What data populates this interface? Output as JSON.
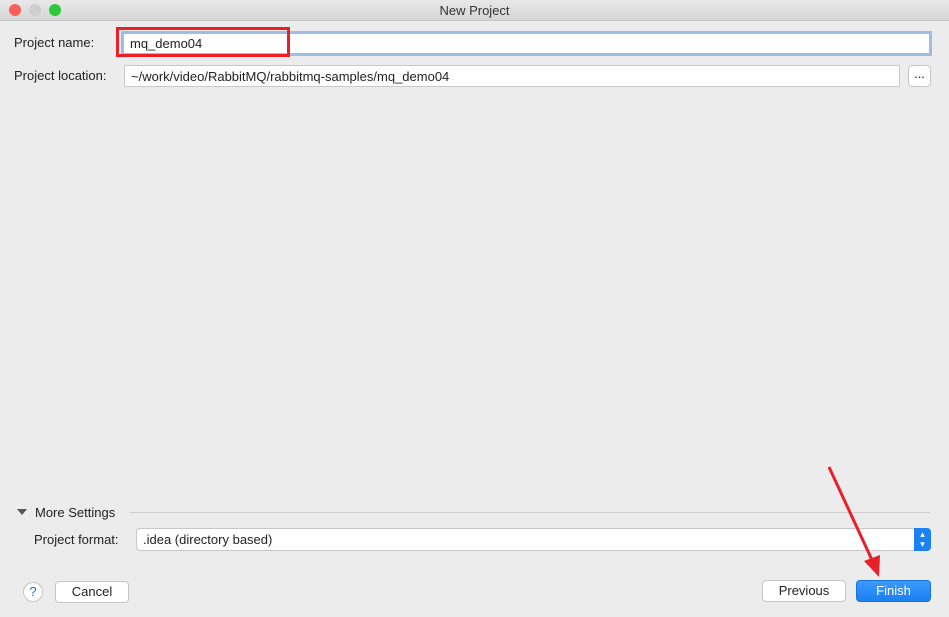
{
  "window": {
    "title": "New Project"
  },
  "form": {
    "name_label": "Project name:",
    "name_value": "mq_demo04",
    "location_label": "Project location:",
    "location_value": "~/work/video/RabbitMQ/rabbitmq-samples/mq_demo04",
    "browse_label": "..."
  },
  "more_settings": {
    "label": "More Settings",
    "format_label": "Project format:",
    "format_value": ".idea (directory based)"
  },
  "footer": {
    "help_label": "?",
    "cancel_label": "Cancel",
    "previous_label": "Previous",
    "finish_label": "Finish"
  },
  "colors": {
    "accent": "#1a82f5",
    "annotation": "#e8202a"
  }
}
